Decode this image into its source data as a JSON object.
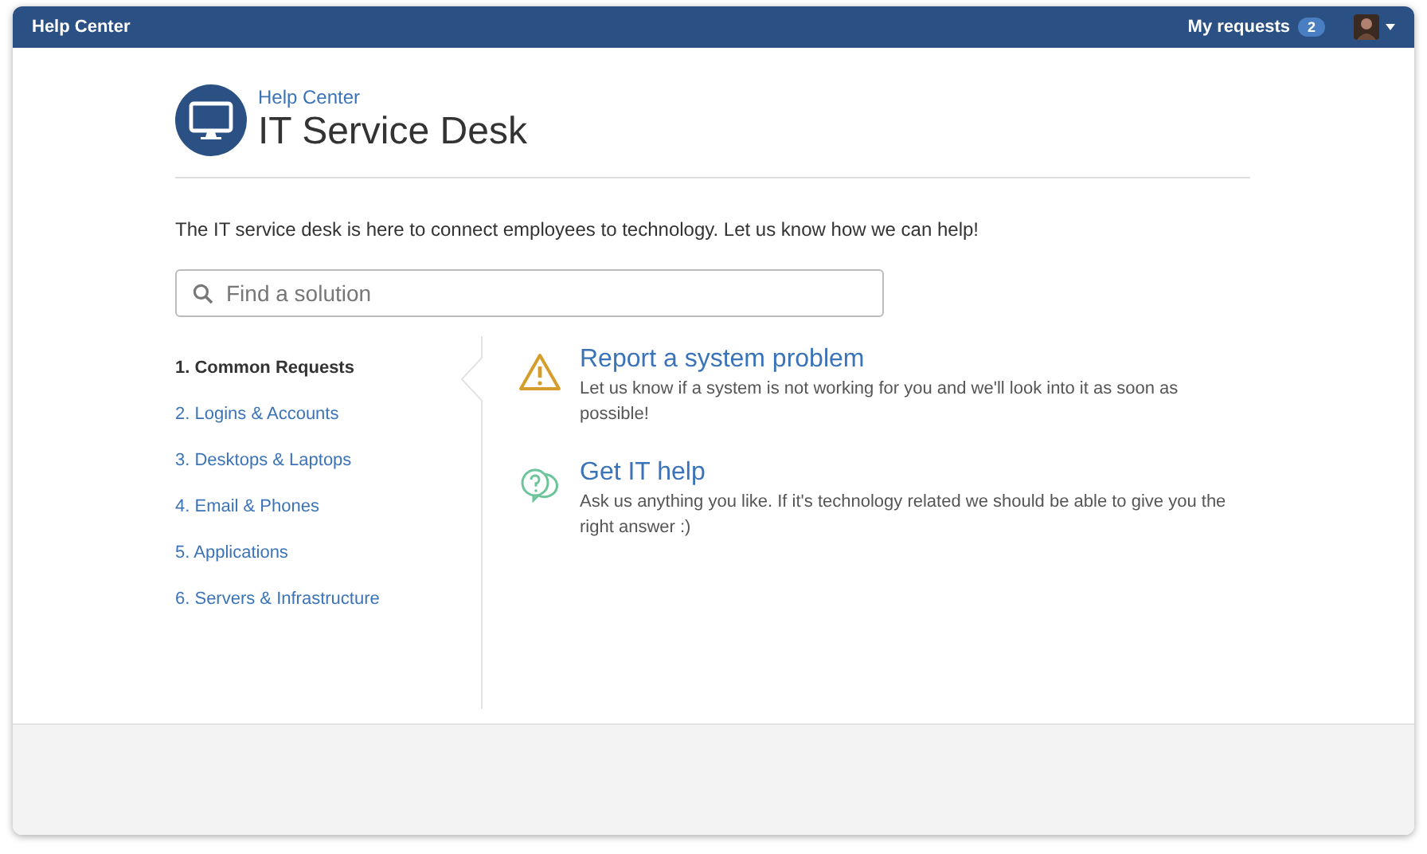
{
  "top_bar": {
    "title": "Help Center",
    "my_requests": "My requests",
    "request_count": "2"
  },
  "header": {
    "breadcrumb": "Help Center",
    "title": "IT Service Desk"
  },
  "intro": "The IT service desk is here to connect employees to technology. Let us know how we can help!",
  "search": {
    "placeholder": "Find a solution"
  },
  "categories": [
    {
      "label": "1. Common Requests",
      "selected": true
    },
    {
      "label": "2. Logins & Accounts",
      "selected": false
    },
    {
      "label": "3. Desktops & Laptops",
      "selected": false
    },
    {
      "label": "4. Email & Phones",
      "selected": false
    },
    {
      "label": "5. Applications",
      "selected": false
    },
    {
      "label": "6. Servers & Infrastructure",
      "selected": false
    }
  ],
  "request_types": [
    {
      "kind": "warning",
      "title": "Report a system problem",
      "description": "Let us know if a system is not working for you and we'll look into it as soon as possible!"
    },
    {
      "kind": "question",
      "title": "Get IT help",
      "description": "Ask us anything you like. If it's technology related we should be able to give you the right answer :)"
    }
  ]
}
